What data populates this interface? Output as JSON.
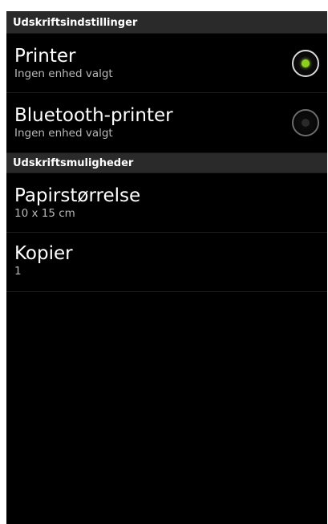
{
  "sections": [
    {
      "header": "Udskriftsindstillinger",
      "items": [
        {
          "title": "Printer",
          "subtitle": "Ingen enhed valgt",
          "selected": true
        },
        {
          "title": "Bluetooth-printer",
          "subtitle": "Ingen enhed valgt",
          "selected": false
        }
      ]
    },
    {
      "header": "Udskriftsmuligheder",
      "items": [
        {
          "title": "Papirstørrelse",
          "subtitle": "10 x 15 cm"
        },
        {
          "title": "Kopier",
          "subtitle": "1"
        }
      ]
    }
  ],
  "colors": {
    "background": "#000000",
    "header_background": "#2a2a2a",
    "radio_selected_dot": "#8bd117"
  }
}
